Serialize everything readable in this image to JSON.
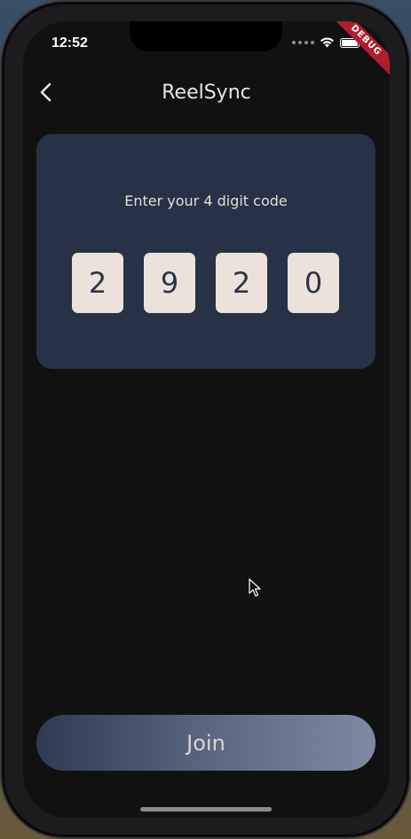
{
  "status_bar": {
    "time": "12:52"
  },
  "debug_banner": "DEBUG",
  "app_bar": {
    "title": "ReelSync",
    "back_icon": "chevron-left-icon"
  },
  "code_card": {
    "label": "Enter your 4 digit code",
    "digits": [
      "2",
      "9",
      "2",
      "0"
    ]
  },
  "join_button": {
    "label": "Join"
  },
  "colors": {
    "screen_bg": "#111112",
    "card_bg": "#273246",
    "digit_bg": "#ece2dc",
    "digit_text": "#2c3348",
    "debug_banner": "#b01e2e"
  }
}
